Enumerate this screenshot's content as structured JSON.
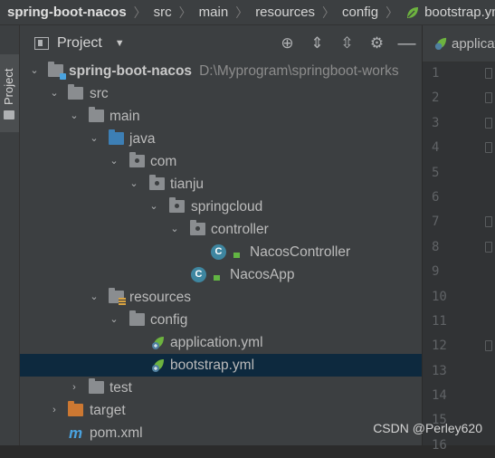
{
  "breadcrumb": [
    "spring-boot-nacos",
    "src",
    "main",
    "resources",
    "config",
    "bootstrap.yml"
  ],
  "tool_stripe": {
    "project_tab": "Project"
  },
  "panel": {
    "title": "Project",
    "icons": [
      "locate-icon",
      "expand-all-icon",
      "collapse-all-icon",
      "settings-icon",
      "hide-icon"
    ]
  },
  "tree": [
    {
      "label": "spring-boot-nacos",
      "path": "D:\\Myprogram\\springboot-works",
      "depth": 0,
      "expanded": true,
      "icon": "module-folder-icon"
    },
    {
      "label": "src",
      "depth": 1,
      "expanded": true,
      "icon": "folder-icon"
    },
    {
      "label": "main",
      "depth": 2,
      "expanded": true,
      "icon": "folder-icon"
    },
    {
      "label": "java",
      "depth": 3,
      "expanded": true,
      "icon": "source-folder-icon"
    },
    {
      "label": "com",
      "depth": 4,
      "expanded": true,
      "icon": "package-icon"
    },
    {
      "label": "tianju",
      "depth": 5,
      "expanded": true,
      "icon": "package-icon"
    },
    {
      "label": "springcloud",
      "depth": 6,
      "expanded": true,
      "icon": "package-icon"
    },
    {
      "label": "controller",
      "depth": 7,
      "expanded": true,
      "icon": "package-icon"
    },
    {
      "label": "NacosController",
      "depth": 8,
      "icon": "class-icon"
    },
    {
      "label": "NacosApp",
      "depth": 7,
      "icon": "spring-class-icon"
    },
    {
      "label": "resources",
      "depth": 3,
      "expanded": true,
      "icon": "resources-folder-icon"
    },
    {
      "label": "config",
      "depth": 4,
      "expanded": true,
      "icon": "folder-icon"
    },
    {
      "label": "application.yml",
      "depth": 5,
      "icon": "spring-yml-icon"
    },
    {
      "label": "bootstrap.yml",
      "depth": 5,
      "icon": "spring-yml-icon",
      "selected": true
    },
    {
      "label": "test",
      "depth": 2,
      "expanded": false,
      "icon": "folder-icon"
    },
    {
      "label": "target",
      "depth": 1,
      "expanded": false,
      "icon": "excluded-folder-icon"
    },
    {
      "label": "pom.xml",
      "depth": 1,
      "icon": "maven-icon"
    }
  ],
  "editor": {
    "tab_label": "application.yml",
    "line_numbers": [
      "1",
      "2",
      "3",
      "4",
      "5",
      "6",
      "7",
      "8",
      "9",
      "10",
      "11",
      "12",
      "13",
      "14",
      "15",
      "16"
    ]
  },
  "watermark": "CSDN @Perley620",
  "colors": {
    "selection": "#0d293e",
    "panel_bg": "#3c3f41",
    "editor_bg": "#2b2b2b",
    "source_folder": "#3d7fb5",
    "excluded_folder": "#cc7832",
    "spring_green": "#6db33f"
  }
}
